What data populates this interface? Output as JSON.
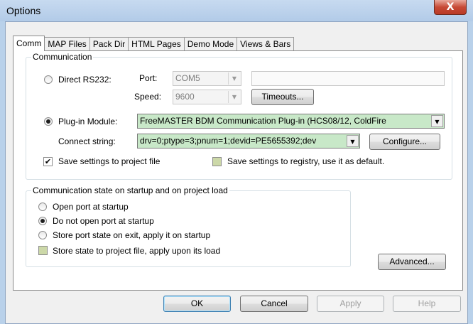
{
  "window": {
    "title": "Options",
    "close_glyph": "X"
  },
  "tabs": [
    {
      "label": "Comm",
      "active": true
    },
    {
      "label": "MAP Files"
    },
    {
      "label": "Pack Dir"
    },
    {
      "label": "HTML Pages"
    },
    {
      "label": "Demo Mode"
    },
    {
      "label": "Views & Bars"
    }
  ],
  "communication": {
    "legend": "Communication",
    "direct_rs232": {
      "label": "Direct RS232:",
      "port_label": "Port:",
      "port_value": "COM5",
      "speed_label": "Speed:",
      "speed_value": "9600",
      "timeouts_label": "Timeouts..."
    },
    "plugin": {
      "label": "Plug-in Module:",
      "module_value": "FreeMASTER BDM Communication Plug-in (HCS08/12, ColdFire",
      "connect_label": "Connect string:",
      "connect_value": "drv=0;ptype=3;pnum=1;devid=PE5655392;dev",
      "configure_label": "Configure..."
    },
    "save_project": {
      "label": "Save settings to project file",
      "checked": true,
      "check_glyph": "✔"
    },
    "save_registry": {
      "label": "Save settings to registry, use it as default.",
      "checked": false
    }
  },
  "startup": {
    "legend": "Communication state on startup and on project load",
    "options": [
      {
        "label": "Open port at startup",
        "checked": false
      },
      {
        "label": "Do not open port at startup",
        "checked": true
      },
      {
        "label": "Store port state on exit, apply it on startup",
        "checked": false
      }
    ],
    "store_state": {
      "label": "Store state to project file, apply upon its load",
      "checked": false
    },
    "advanced_label": "Advanced..."
  },
  "footer": {
    "ok": "OK",
    "cancel": "Cancel",
    "apply": "Apply",
    "help": "Help"
  },
  "icons": {
    "dropdown": "▼"
  },
  "colors": {
    "title_bar": "#b9d1ea",
    "close_button": "#c74a36",
    "plugin_field": "#c8e8c8"
  }
}
